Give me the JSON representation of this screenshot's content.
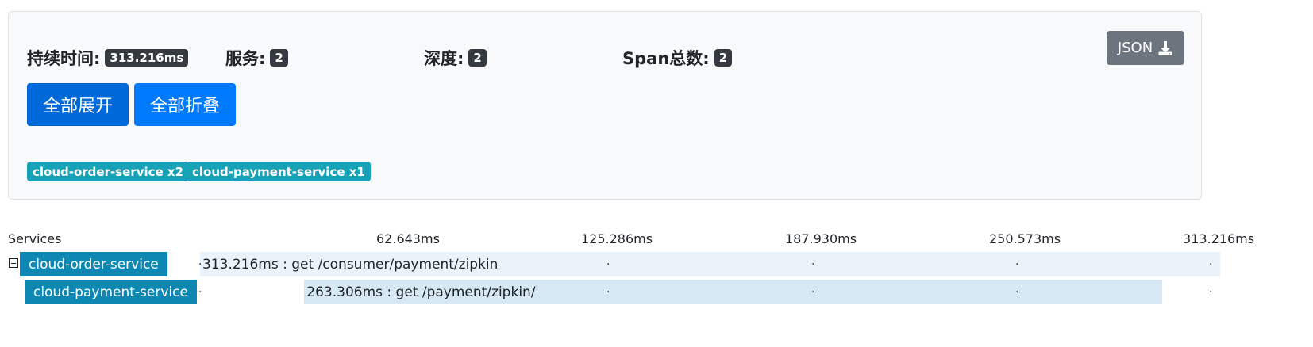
{
  "summary": {
    "duration_label": "持续时间:",
    "duration_value": "313.216ms",
    "services_label": "服务:",
    "services_value": "2",
    "depth_label": "深度:",
    "depth_value": "2",
    "span_label": "Span总数:",
    "span_value": "2",
    "json_button_label": "JSON"
  },
  "actions": {
    "expand_all": "全部展开",
    "collapse_all": "全部折叠"
  },
  "service_badges": [
    "cloud-order-service x2",
    "cloud-payment-service x1"
  ],
  "timeline": {
    "services_header": "Services",
    "ticks": [
      "62.643ms",
      "125.286ms",
      "187.930ms",
      "250.573ms",
      "313.216ms"
    ],
    "total_ms": 313.216,
    "spans": [
      {
        "service": "cloud-order-service",
        "label": "313.216ms : get /consumer/payment/zipkin",
        "start_ms": 0,
        "duration_ms": 313.216
      },
      {
        "service": "cloud-payment-service",
        "label": "263.306ms : get /payment/zipkin/",
        "start_ms": 32.0,
        "duration_ms": 263.306
      }
    ]
  },
  "colors": {
    "accent_primary": "#007bff",
    "accent_active": "#0069d9",
    "service_badge": "#17a2b8",
    "service_label": "#0e88b3",
    "json_button": "#6c757d",
    "dark_badge": "#343a40"
  },
  "icons": {
    "json_button_icon": "download-icon",
    "tree_toggle_icon": "collapse-square-icon"
  }
}
